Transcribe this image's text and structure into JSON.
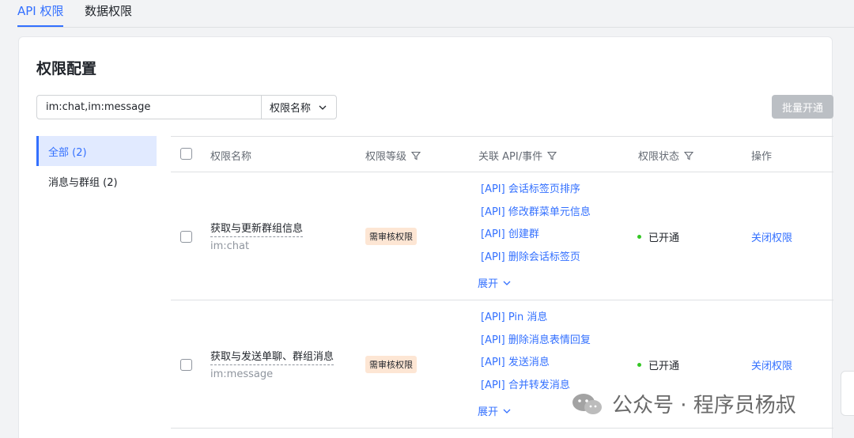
{
  "tabs": [
    {
      "label": "API 权限",
      "active": true
    },
    {
      "label": "数据权限",
      "active": false
    }
  ],
  "card": {
    "title": "权限配置",
    "search": {
      "value": "im:chat,im:message",
      "select_label": "权限名称"
    },
    "batch_button": "批量开通"
  },
  "sidebar": {
    "items": [
      {
        "label": "全部 (2)",
        "active": true
      },
      {
        "label": "消息与群组 (2)",
        "active": false
      }
    ]
  },
  "table": {
    "headers": {
      "name": "权限名称",
      "level": "权限等级",
      "api": "关联 API/事件",
      "status": "权限状态",
      "action": "操作"
    },
    "rows": [
      {
        "name": "获取与更新群组信息",
        "code": "im:chat",
        "level": "需审核权限",
        "apis": [
          "[API] 会话标签页排序",
          "[API] 修改群菜单元信息",
          "[API] 创建群",
          "[API] 删除会话标签页"
        ],
        "expand": "展开",
        "status": "已开通",
        "action": "关闭权限"
      },
      {
        "name": "获取与发送单聊、群组消息",
        "code": "im:message",
        "level": "需审核权限",
        "apis": [
          "[API] Pin 消息",
          "[API] 删除消息表情回复",
          "[API] 发送消息",
          "[API] 合并转发消息"
        ],
        "expand": "展开",
        "status": "已开通",
        "action": "关闭权限"
      }
    ]
  },
  "watermark": {
    "text": "公众号 · 程序员杨叔"
  },
  "colors": {
    "accent": "#3370ff",
    "badge_bg": "#fde6d4",
    "status_dot": "#34c724",
    "disabled_btn": "#bbbfc4"
  }
}
